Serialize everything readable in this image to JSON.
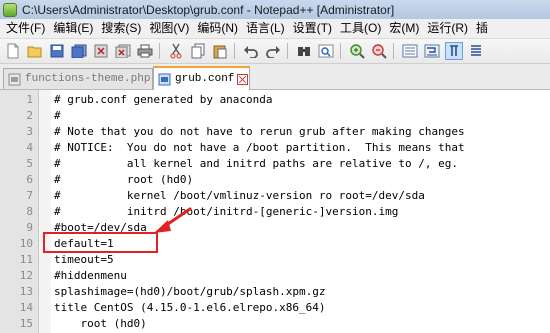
{
  "window": {
    "title": "C:\\Users\\Administrator\\Desktop\\grub.conf - Notepad++ [Administrator]"
  },
  "menu": [
    {
      "label": "文件(F)",
      "name": "menu-file"
    },
    {
      "label": "编辑(E)",
      "name": "menu-edit"
    },
    {
      "label": "搜索(S)",
      "name": "menu-search"
    },
    {
      "label": "视图(V)",
      "name": "menu-view"
    },
    {
      "label": "编码(N)",
      "name": "menu-encoding"
    },
    {
      "label": "语言(L)",
      "name": "menu-language"
    },
    {
      "label": "设置(T)",
      "name": "menu-settings"
    },
    {
      "label": "工具(O)",
      "name": "menu-tools"
    },
    {
      "label": "宏(M)",
      "name": "menu-macro"
    },
    {
      "label": "运行(R)",
      "name": "menu-run"
    },
    {
      "label": "插",
      "name": "menu-plugins"
    }
  ],
  "toolbar": {
    "icons": [
      "new-file-icon",
      "open-file-icon",
      "save-icon",
      "save-all-icon",
      "close-icon",
      "close-all-icon",
      "print-icon",
      "cut-icon",
      "copy-icon",
      "paste-icon",
      "undo-icon",
      "redo-icon",
      "find-icon",
      "replace-icon",
      "zoom-in-icon",
      "zoom-out-icon",
      "sync-scroll-icon",
      "word-wrap-icon",
      "show-all-characters-icon",
      "indent-guide-icon"
    ]
  },
  "tabs": [
    {
      "label": "functions-theme.php",
      "active": false
    },
    {
      "label": "grub.conf",
      "active": true
    }
  ],
  "editor": {
    "lines": [
      {
        "num": "1",
        "text": "# grub.conf generated by anaconda"
      },
      {
        "num": "2",
        "text": "#"
      },
      {
        "num": "3",
        "text": "# Note that you do not have to rerun grub after making changes"
      },
      {
        "num": "4",
        "text": "# NOTICE:  You do not have a /boot partition.  This means that"
      },
      {
        "num": "5",
        "text": "#          all kernel and initrd paths are relative to /, eg."
      },
      {
        "num": "6",
        "text": "#          root (hd0)"
      },
      {
        "num": "7",
        "text": "#          kernel /boot/vmlinuz-version ro root=/dev/sda"
      },
      {
        "num": "8",
        "text": "#          initrd /boot/initrd-[generic-]version.img"
      },
      {
        "num": "9",
        "text": "#boot=/dev/sda"
      },
      {
        "num": "10",
        "text": "default=1"
      },
      {
        "num": "11",
        "text": "timeout=5"
      },
      {
        "num": "12",
        "text": "#hiddenmenu"
      },
      {
        "num": "13",
        "text": "splashimage=(hd0)/boot/grub/splash.xpm.gz"
      },
      {
        "num": "14",
        "text": "title CentOS (4.15.0-1.el6.elrepo.x86_64)"
      },
      {
        "num": "15",
        "text": "    root (hd0)"
      }
    ]
  },
  "colors": {
    "annotation": "#e02222",
    "active_tab_accent": "#f2a23a"
  }
}
